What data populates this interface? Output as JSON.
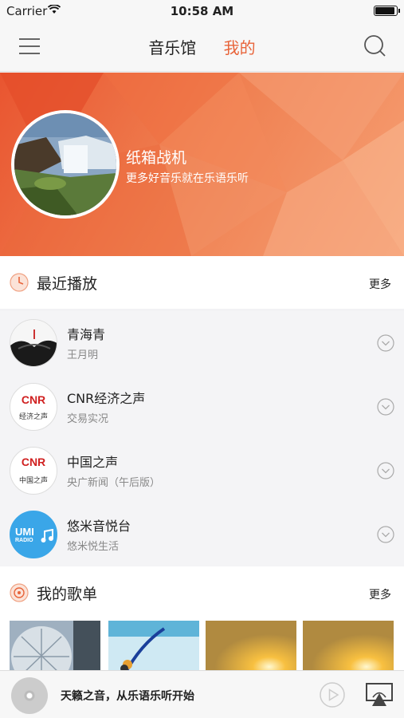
{
  "status": {
    "carrier": "Carrier",
    "time": "10:58 AM",
    "battery": 0.95
  },
  "nav": {
    "tabs": [
      "音乐馆",
      "我的"
    ],
    "active": 1
  },
  "profile": {
    "name": "纸箱战机",
    "subtitle": "更多好音乐就在乐语乐听"
  },
  "recent": {
    "title": "最近播放",
    "more": "更多",
    "items": [
      {
        "title": "青海青",
        "subtitle": "王月明",
        "thumb": "ink-art"
      },
      {
        "title": "CNR经济之声",
        "subtitle": "交易实况",
        "thumb": "cnr-economy",
        "logo": "CNR",
        "caption": "经济之声"
      },
      {
        "title": "中国之声",
        "subtitle": "央广新闻（午后版）",
        "thumb": "cnr-china",
        "logo": "CNR",
        "caption": "中国之声"
      },
      {
        "title": "悠米音悦台",
        "subtitle": "悠米悦生活",
        "thumb": "umi-radio",
        "logo": "UMI",
        "caption": "RADIO"
      }
    ]
  },
  "playlists": {
    "title": "我的歌单",
    "more": "更多"
  },
  "player": {
    "message": "天籁之音，从乐语乐听开始"
  }
}
